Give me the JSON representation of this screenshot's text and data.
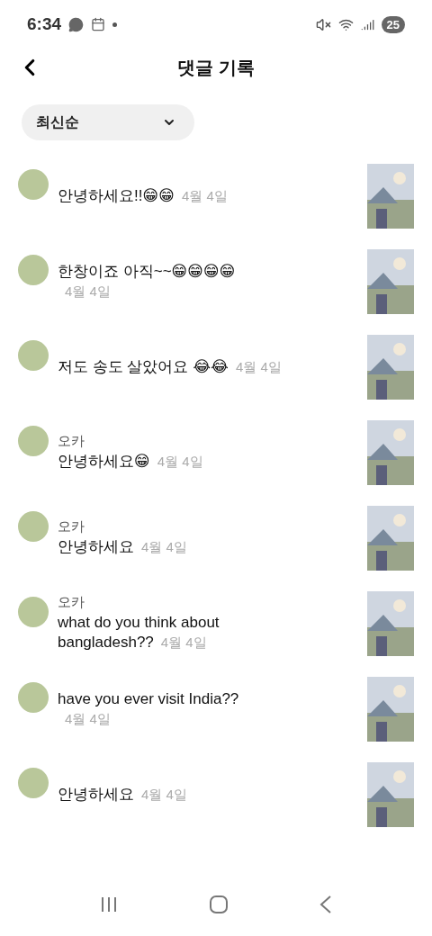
{
  "status_bar": {
    "time": "6:34",
    "battery": "25"
  },
  "header": {
    "title": "댓글 기록"
  },
  "sort": {
    "label": "최신순"
  },
  "comments": [
    {
      "text": "안녕하세요!!😁😁",
      "date": "4월 4일"
    },
    {
      "text": "한창이죠 아직~~😁😁😁😁",
      "date": "4월 4일"
    },
    {
      "text": "저도 송도 살았어요 😂😂",
      "date": "4월 4일"
    },
    {
      "name": "오카",
      "text": "안녕하세요😁",
      "date": "4월 4일"
    },
    {
      "name": "오카",
      "text": "안녕하세요",
      "date": "4월 4일"
    },
    {
      "name": "오카",
      "text": "what do you think about bangladesh??",
      "date": "4월 4일"
    },
    {
      "text": "have you ever visit India??",
      "date": "4월 4일"
    },
    {
      "text": "안녕하세요",
      "date": "4월 4일"
    }
  ]
}
